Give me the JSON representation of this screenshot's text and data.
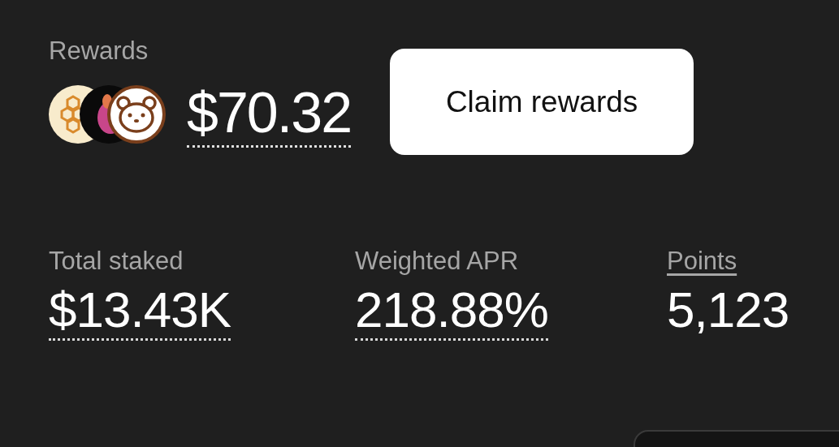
{
  "rewards": {
    "label": "Rewards",
    "amount": "$70.32",
    "button": "Claim rewards"
  },
  "stats": [
    {
      "label": "Total staked",
      "value": "$13.43K",
      "label_link": false,
      "value_dotted": true
    },
    {
      "label": "Weighted APR",
      "value": "218.88%",
      "label_link": false,
      "value_dotted": true
    },
    {
      "label": "Points",
      "value": "5,123",
      "label_link": true,
      "value_dotted": false
    }
  ]
}
